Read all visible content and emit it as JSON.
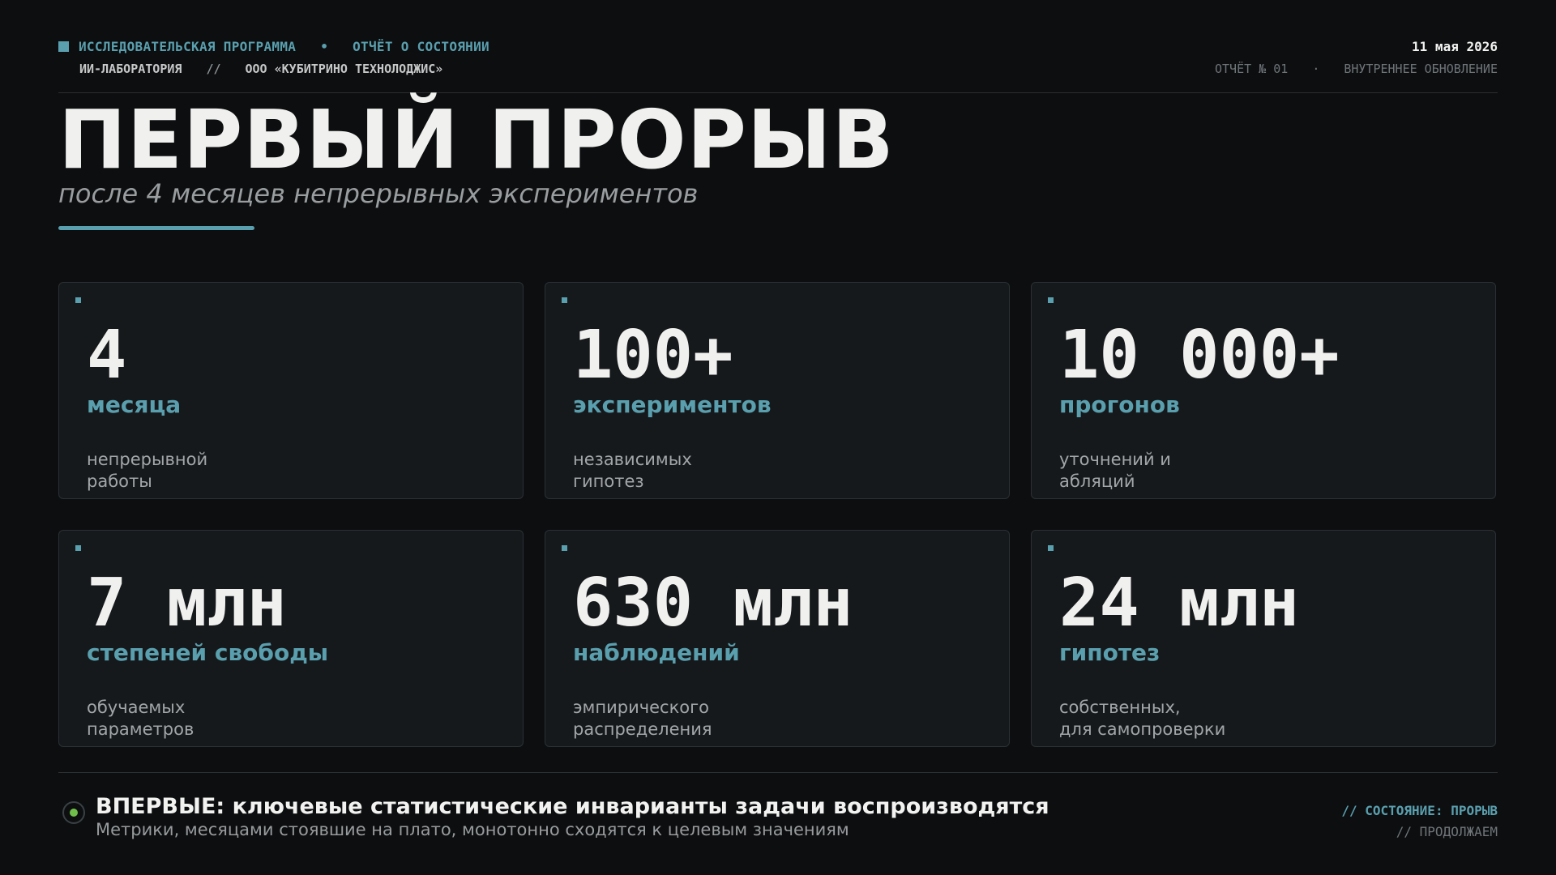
{
  "header": {
    "program": "ИССЛЕДОВАТЕЛЬСКАЯ ПРОГРАММА",
    "bullet": "•",
    "report_type": "ОТЧЁТ О СОСТОЯНИИ",
    "lab": "ИИ-ЛАБОРАТОРИЯ",
    "separator": "//",
    "company": "ООО «КУБИТРИНО ТЕХНОЛОДЖИС»",
    "date": "11 мая 2026",
    "report_number": "ОТЧЁТ № 01",
    "dot": "·",
    "update_type": "ВНУТРЕННЕЕ ОБНОВЛЕНИЕ"
  },
  "main": {
    "title": "ПЕРВЫЙ ПРОРЫВ",
    "subtitle": "после 4 месяцев непрерывных экспериментов"
  },
  "cards": [
    {
      "value": "4",
      "unit": "месяца",
      "desc1": "непрерывной",
      "desc2": "работы"
    },
    {
      "value": "100+",
      "unit": "экспериментов",
      "desc1": "независимых",
      "desc2": "гипотез"
    },
    {
      "value": "10 000+",
      "unit": "прогонов",
      "desc1": "уточнений и",
      "desc2": "абляций"
    },
    {
      "value": "7 млн",
      "unit": "степеней свободы",
      "desc1": "обучаемых",
      "desc2": "параметров"
    },
    {
      "value": "630 млн",
      "unit": "наблюдений",
      "desc1": "эмпирического",
      "desc2": "распределения"
    },
    {
      "value": "24 млн",
      "unit": "гипотез",
      "desc1": "собственных,",
      "desc2": "для самопроверки"
    }
  ],
  "footer": {
    "title": "ВПЕРВЫЕ: ключевые статистические инварианты задачи воспроизводятся",
    "subtitle": "Метрики, месяцами стоявшие на плато, монотонно сходятся к целевым значениям",
    "status": "// СОСТОЯНИЕ: ПРОРЫВ",
    "continue": "// ПРОДОЛЖАЕМ",
    "status_color": "#6fbf4a"
  },
  "colors": {
    "accent": "#5a9fae",
    "background": "#0c0e10",
    "card": "#16191c"
  }
}
